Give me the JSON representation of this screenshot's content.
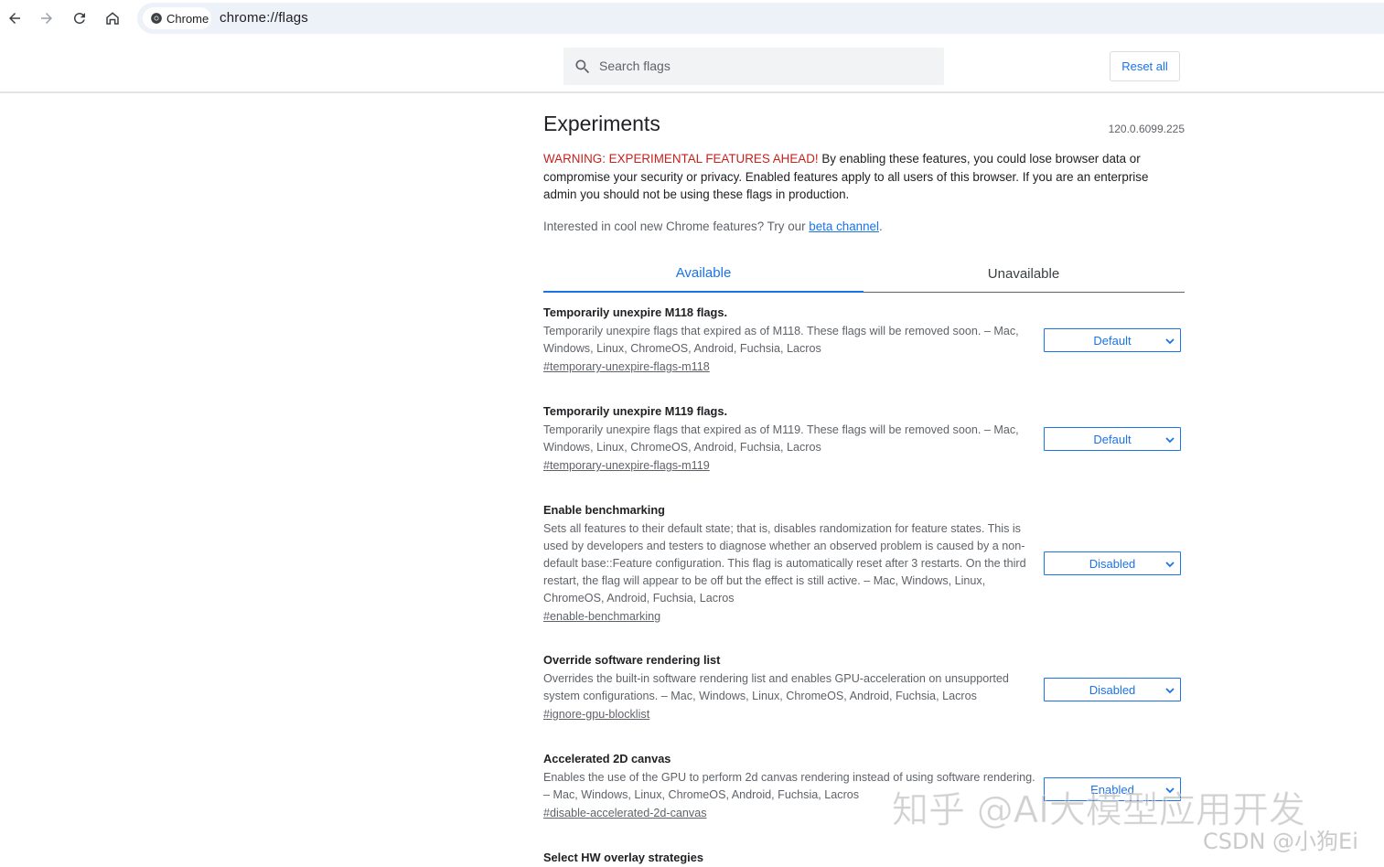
{
  "browser": {
    "site_chip": "Chrome",
    "url": "chrome://flags"
  },
  "flags_header": {
    "search_placeholder": "Search flags",
    "reset_label": "Reset all"
  },
  "page": {
    "title": "Experiments",
    "version": "120.0.6099.225",
    "warning_label": "WARNING: EXPERIMENTAL FEATURES AHEAD!",
    "warning_text": " By enabling these features, you could lose browser data or compromise your security or privacy. Enabled features apply to all users of this browser. If you are an enterprise admin you should not be using these flags in production.",
    "promo_text": "Interested in cool new Chrome features? Try our ",
    "promo_link": "beta channel",
    "promo_end": "."
  },
  "tabs": [
    {
      "label": "Available",
      "active": true
    },
    {
      "label": "Unavailable",
      "active": false
    }
  ],
  "flags": [
    {
      "title": "Temporarily unexpire M118 flags.",
      "description": "Temporarily unexpire flags that expired as of M118. These flags will be removed soon. – Mac, Windows, Linux, ChromeOS, Android, Fuchsia, Lacros",
      "link": "#temporary-unexpire-flags-m118",
      "value": "Default"
    },
    {
      "title": "Temporarily unexpire M119 flags.",
      "description": "Temporarily unexpire flags that expired as of M119. These flags will be removed soon. – Mac, Windows, Linux, ChromeOS, Android, Fuchsia, Lacros",
      "link": "#temporary-unexpire-flags-m119",
      "value": "Default"
    },
    {
      "title": "Enable benchmarking",
      "description": "Sets all features to their default state; that is, disables randomization for feature states. This is used by developers and testers to diagnose whether an observed problem is caused by a non-default base::Feature configuration. This flag is automatically reset after 3 restarts. On the third restart, the flag will appear to be off but the effect is still active. – Mac, Windows, Linux, ChromeOS, Android, Fuchsia, Lacros",
      "link": "#enable-benchmarking",
      "value": "Disabled"
    },
    {
      "title": "Override software rendering list",
      "description": "Overrides the built-in software rendering list and enables GPU-acceleration on unsupported system configurations. – Mac, Windows, Linux, ChromeOS, Android, Fuchsia, Lacros",
      "link": "#ignore-gpu-blocklist",
      "value": "Disabled"
    },
    {
      "title": "Accelerated 2D canvas",
      "description": "Enables the use of the GPU to perform 2d canvas rendering instead of using software rendering. – Mac, Windows, Linux, ChromeOS, Android, Fuchsia, Lacros",
      "link": "#disable-accelerated-2d-canvas",
      "value": "Enabled"
    },
    {
      "title": "Select HW overlay strategies",
      "description": "",
      "link": "",
      "value": ""
    }
  ],
  "watermark": {
    "main": "知乎 @AI大模型应用开发",
    "sub": "CSDN @小狗Ei"
  }
}
